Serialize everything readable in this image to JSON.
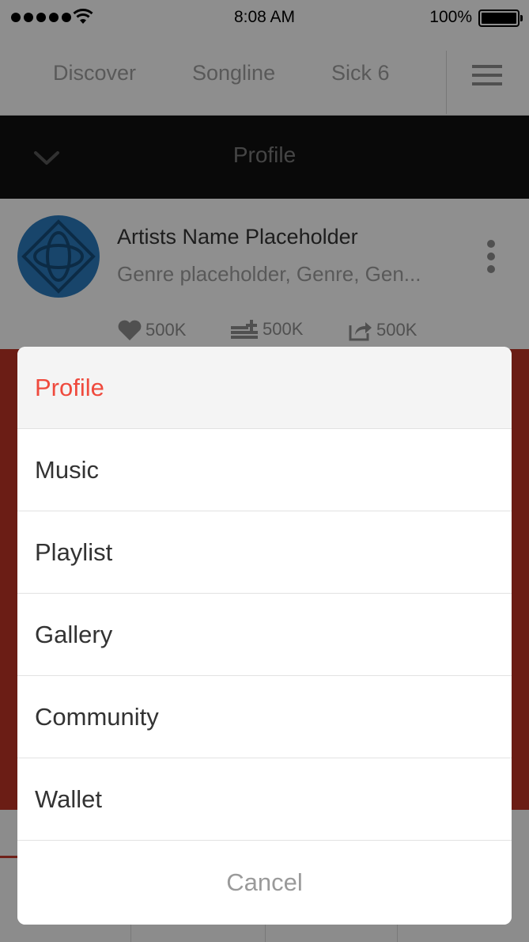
{
  "status_bar": {
    "time": "8:08 AM",
    "battery": "100%",
    "icons": [
      "signal-dots-icon",
      "wifi-icon",
      "battery-icon"
    ]
  },
  "top_nav": {
    "items": [
      {
        "label": "Discover"
      },
      {
        "label": "Songline"
      },
      {
        "label": "Sick 6"
      }
    ],
    "menu_icon": "hamburger-icon"
  },
  "profile_bar": {
    "title": "Profile",
    "collapse_icon": "chevron-down-icon"
  },
  "artist": {
    "name": "Artists Name Placeholder",
    "genre": "Genre placeholder, Genre, Gen...",
    "more_icon": "more-vertical-icon",
    "stats": {
      "likes": "500K",
      "playlist_adds": "500K",
      "shares": "500K"
    }
  },
  "action_sheet": {
    "options": [
      {
        "label": "Profile",
        "selected": true
      },
      {
        "label": "Music",
        "selected": false
      },
      {
        "label": "Playlist",
        "selected": false
      },
      {
        "label": "Gallery",
        "selected": false
      },
      {
        "label": "Community",
        "selected": false
      },
      {
        "label": "Wallet",
        "selected": false
      }
    ],
    "cancel_label": "Cancel"
  },
  "colors": {
    "accent": "#ef4a3d",
    "panel_red": "#b83225",
    "avatar_blue": "#2a78b8",
    "header_black": "#111111"
  }
}
